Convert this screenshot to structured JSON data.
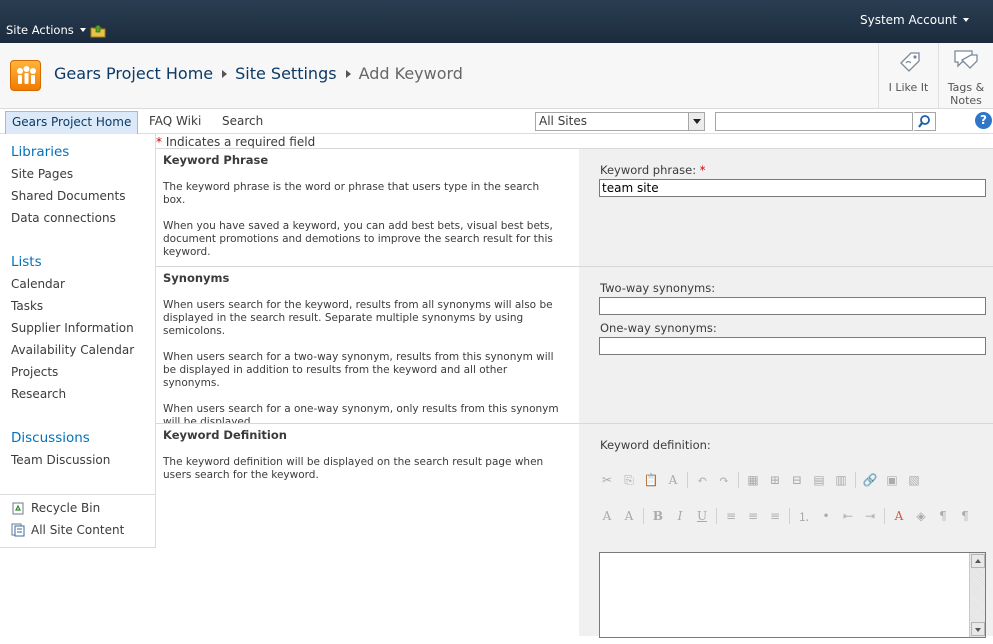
{
  "topbar": {
    "site_actions": "Site Actions",
    "account": "System Account"
  },
  "title": {
    "crumbs": [
      "Gears Project Home",
      "Site Settings",
      "Add Keyword"
    ]
  },
  "social": {
    "like": "I Like It",
    "tags_line1": "Tags &",
    "tags_line2": "Notes"
  },
  "topnav": {
    "tabs": [
      "Gears Project Home",
      "FAQ Wiki",
      "Search"
    ],
    "scope": "All Sites",
    "search_value": "",
    "help": "?"
  },
  "leftnav": {
    "libraries": {
      "heading": "Libraries",
      "items": [
        "Site Pages",
        "Shared Documents",
        "Data connections"
      ]
    },
    "lists": {
      "heading": "Lists",
      "items": [
        "Calendar",
        "Tasks",
        "Supplier Information",
        "Availability Calendar",
        "Projects",
        "Research"
      ]
    },
    "discussions": {
      "heading": "Discussions",
      "items": [
        "Team Discussion"
      ]
    },
    "recycle_bin": "Recycle Bin",
    "all_site_content": "All Site Content"
  },
  "form": {
    "required_star": "*",
    "required_note": "Indicates a required field",
    "keyword": {
      "title": "Keyword Phrase",
      "p1": "The keyword phrase is the word or phrase that users type in the search box.",
      "p2": "When you have saved a keyword, you can add best bets, visual best bets, document promotions and demotions to improve the search result for this keyword.",
      "label": "Keyword phrase:",
      "value": "team site"
    },
    "synonyms": {
      "title": "Synonyms",
      "p1": "When users search for the keyword, results from all synonyms will also be displayed in the search result.  Separate multiple synonyms by using semicolons.",
      "p2": "When users search for a two-way synonym, results from this synonym will be displayed in addition to results from the keyword and all other synonyms.",
      "p3": "When users search for a one-way synonym, only results from this synonym will be displayed.",
      "two_way_label": "Two-way synonyms:",
      "two_way_value": "",
      "one_way_label": "One-way synonyms:",
      "one_way_value": ""
    },
    "definition": {
      "title": "Keyword Definition",
      "p1": "The keyword definition will be displayed on the search result page when users search for the keyword.",
      "label": "Keyword definition:",
      "value": ""
    }
  },
  "colors": {
    "topbar": "#1c2c3e",
    "link": "#0072bc",
    "required": "#cc0000",
    "field_bg": "#f0f0f0"
  }
}
